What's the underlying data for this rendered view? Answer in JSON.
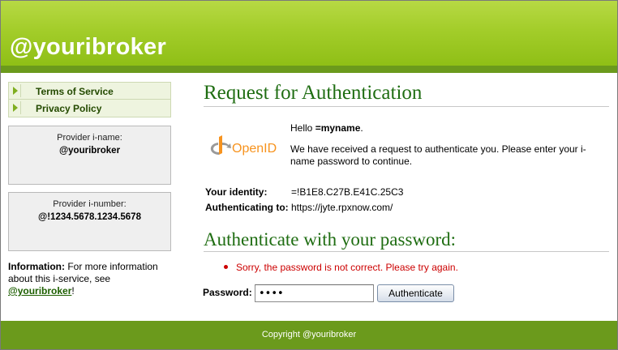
{
  "header": {
    "title": "@youribroker"
  },
  "nav": {
    "items": [
      {
        "label": "Terms of Service"
      },
      {
        "label": "Privacy Policy"
      }
    ]
  },
  "provider": {
    "iname_caption": "Provider i-name:",
    "iname_value": "@youribroker",
    "inumber_caption": "Provider i-number:",
    "inumber_value": "@!1234.5678.1234.5678"
  },
  "information": {
    "label": "Information:",
    "text": " For more information about this i-service, see ",
    "link": "@youribroker",
    "suffix": "!"
  },
  "request": {
    "title": "Request for Authentication",
    "logo_text": "OpenID",
    "hello_prefix": "Hello ",
    "hello_name": "=myname",
    "hello_suffix": ".",
    "description": "We have received a request to authenticate you. Please enter your i-name password to continue.",
    "identity_label": "Your identity:",
    "identity_value": "=!B1E8.C27B.E41C.25C3",
    "auth_to_label": "Authenticating to:",
    "auth_to_value": "https://jyte.rpxnow.com/"
  },
  "auth": {
    "title": "Authenticate with your password:",
    "error": "Sorry, the password is not correct. Please try again.",
    "password_label": "Password:",
    "password_value": "abcd",
    "button_label": "Authenticate"
  },
  "footer": {
    "text": "Copyright @youribroker"
  },
  "colors": {
    "brand_green": "#a3cd2a",
    "dark_green": "#6b9a1c",
    "heading_green": "#1f6d12",
    "error_red": "#cc0000",
    "openid_orange": "#f7931e"
  }
}
